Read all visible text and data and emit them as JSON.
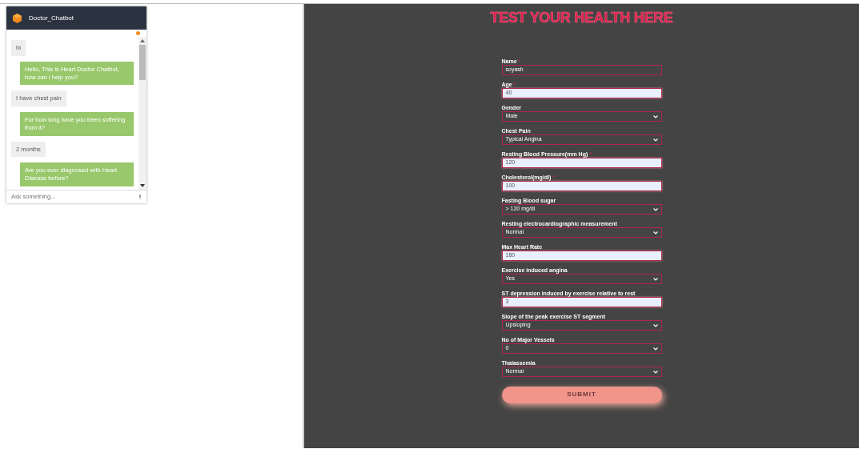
{
  "chatbot": {
    "title": "Doctor_Chatbot",
    "messages": [
      {
        "kind": "user",
        "text": "hi"
      },
      {
        "kind": "bot",
        "text": "Hello, This is Heart Doctor Chatbot, how can i help you?"
      },
      {
        "kind": "user",
        "text": "I have chest pain"
      },
      {
        "kind": "bot",
        "text": "For how long have you been suffering from it?"
      },
      {
        "kind": "user",
        "text": "2 months"
      },
      {
        "kind": "bot",
        "text": "Are you ever diagnosed with Heart Disease before?"
      }
    ],
    "input": {
      "placeholder": "Ask something..."
    }
  },
  "form": {
    "title": "TEST YOUR HEALTH HERE",
    "fields": [
      {
        "label": "Name",
        "required_mark": "*",
        "kind": "text",
        "autofilled": false,
        "value": "soyash"
      },
      {
        "label": "Age",
        "required_mark": "*",
        "kind": "text",
        "autofilled": true,
        "value": "40"
      },
      {
        "label": "Gender",
        "kind": "select",
        "value": "Male"
      },
      {
        "label": "Chest Pain",
        "kind": "select",
        "value": "Typical Angina"
      },
      {
        "label": "Resting Blood Pressure(mm Hg)",
        "required_mark": "*",
        "kind": "text",
        "autofilled": true,
        "value": "120"
      },
      {
        "label": "Cholesterol(mg/dl)",
        "required_mark": "*",
        "kind": "text",
        "autofilled": true,
        "value": "100"
      },
      {
        "label": "Fasting Blood sugar",
        "kind": "select",
        "value": "> 120 mg/dl"
      },
      {
        "label": "Resting electrocardiographic measurement",
        "kind": "select",
        "value": "Normal"
      },
      {
        "label": "Max Heart Rate",
        "kind": "text",
        "autofilled": true,
        "value": "180"
      },
      {
        "label": "Exercise induced angina",
        "kind": "select",
        "value": "Yes"
      },
      {
        "label": "ST depression induced by exercise relative to rest",
        "kind": "text",
        "autofilled": true,
        "value": "3"
      },
      {
        "label": "Slope of the peak exercise ST segment",
        "kind": "select",
        "value": "Upsloping"
      },
      {
        "label": "No of Major Vessels",
        "kind": "select",
        "value": "0"
      },
      {
        "label": "Thalassemia",
        "kind": "select",
        "value": "Normal"
      }
    ],
    "submit": "SUBMIT"
  }
}
